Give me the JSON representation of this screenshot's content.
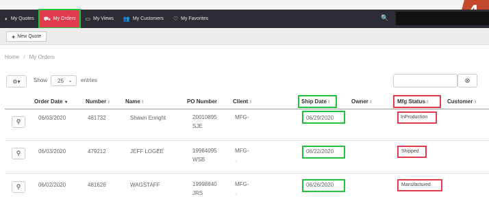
{
  "badge": "4",
  "nav": {
    "items": [
      {
        "label": "My Quotes",
        "icon": "quotes-icon",
        "glyph": "◐"
      },
      {
        "label": "My Orders",
        "icon": "truck-icon",
        "glyph": "⛟"
      },
      {
        "label": "My Views",
        "icon": "folder-icon",
        "glyph": "▭"
      },
      {
        "label": "My Customers",
        "icon": "users-icon",
        "glyph": "👥"
      },
      {
        "label": "My Favorites",
        "icon": "heart-icon",
        "glyph": "♡"
      }
    ],
    "search_glyph": "🔍"
  },
  "toolbar": {
    "new_quote_label": "New Quote",
    "new_quote_icon": "+"
  },
  "breadcrumb": {
    "home": "Home",
    "current": "My Orders"
  },
  "controls": {
    "gear_glyph": "⚙▾",
    "show_label": "Show",
    "entries_value": "25",
    "entries_label": "entries",
    "filter_glyph": "⊗"
  },
  "table": {
    "columns": [
      "Order Date",
      "Number",
      "Name",
      "PO Number",
      "Client",
      "Ship Date",
      "Owner",
      "Mfg Status",
      "Customer"
    ],
    "rows": [
      {
        "order_date": "06/03/2020",
        "number": "481732",
        "name": "Shawn Enright",
        "po_line1": "20010895",
        "po_line2": "SJE",
        "client_line1": "MFG-",
        "client_line2": "",
        "ship_date": "06/29/2020",
        "mfg_status": "InProduction"
      },
      {
        "order_date": "06/03/2020",
        "number": "479212",
        "name": "JEFF LOGEE",
        "po_line1": "19984095",
        "po_line2": "WSB",
        "client_line1": "MFG-",
        "client_line2": ".",
        "ship_date": "06/22/2020",
        "mfg_status": "Shipped"
      },
      {
        "order_date": "06/02/2020",
        "number": "481626",
        "name": "WAGSTAFF",
        "po_line1": "19998840",
        "po_line2": "JRS",
        "client_line1": "MFG-",
        "client_line2": ".",
        "ship_date": "06/26/2020",
        "mfg_status": "Manufactured"
      }
    ]
  },
  "colors": {
    "navbar": "#2c2c34",
    "active_tab": "#e23b4f",
    "highlight_green": "#22c23c",
    "highlight_red": "#e23b4f",
    "badge": "#c4482e"
  }
}
